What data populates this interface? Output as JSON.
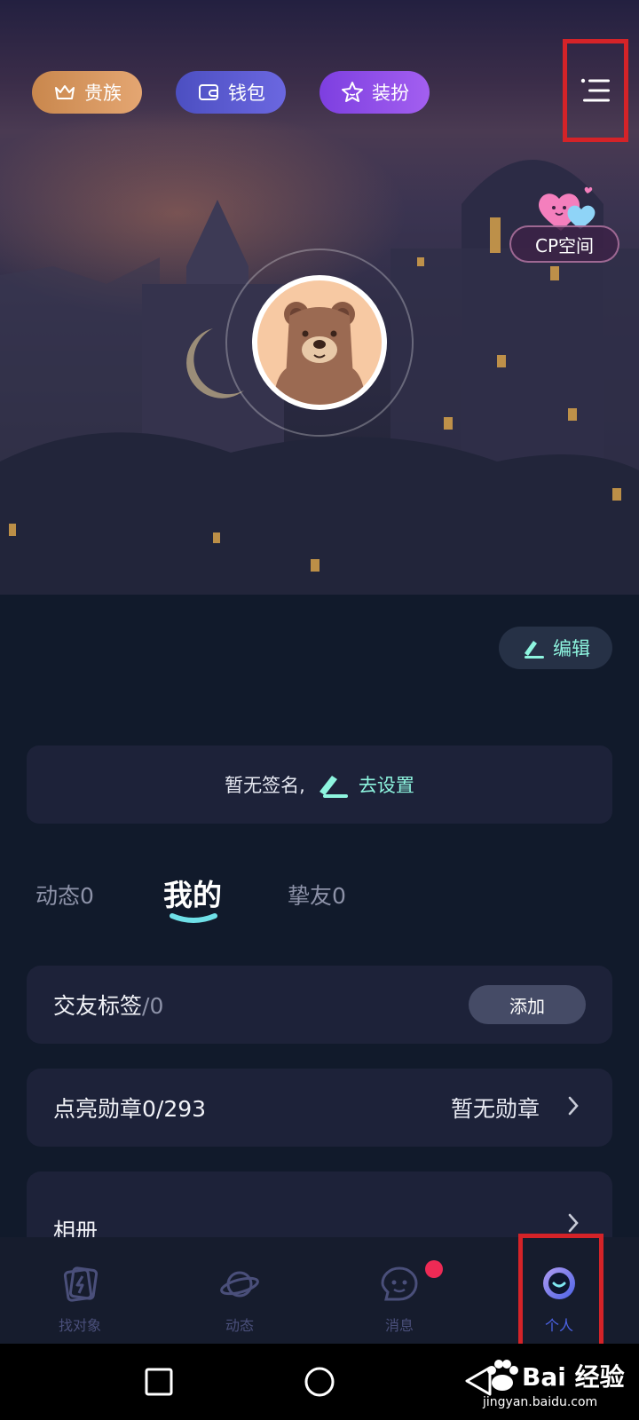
{
  "header": {
    "noble_label": "贵族",
    "wallet_label": "钱包",
    "dress_label": "装扮"
  },
  "cp": {
    "label": "CP空间"
  },
  "profile": {
    "edit_label": "编辑",
    "signature_text": "暂无签名,",
    "signature_action": "去设置"
  },
  "tabs": [
    {
      "label": "动态0"
    },
    {
      "label": "我的"
    },
    {
      "label": "挚友0"
    }
  ],
  "sections": {
    "tags_label": "交友标签",
    "tags_count": "/0",
    "tags_add": "添加",
    "medal_label": "点亮勋章0/293",
    "medal_status": "暂无勋章",
    "album_label": "相册"
  },
  "tabbar": [
    {
      "label": "找对象",
      "icon": "lightning-card-icon"
    },
    {
      "label": "动态",
      "icon": "planet-icon"
    },
    {
      "label": "消息",
      "icon": "chat-bubble-icon"
    },
    {
      "label": "个人",
      "icon": "person-face-icon"
    }
  ],
  "watermark": {
    "brand": "Bai 经验",
    "url": "jingyan.baidu.com"
  },
  "colors": {
    "accent_mint": "#8ef5df",
    "tab_active": "#4c63e6",
    "highlight": "#d42328",
    "badge": "#ee2a55"
  }
}
